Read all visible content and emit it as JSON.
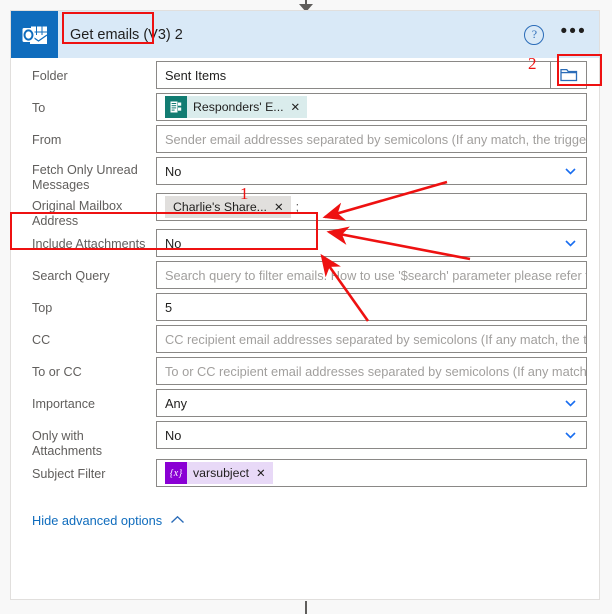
{
  "connector": {
    "top_icon": "arrow-down",
    "bottom_icon": "vertical-line"
  },
  "header": {
    "app_icon": "outlook-icon",
    "title": "Get emails (V3) 2",
    "help_icon": "help-icon",
    "help_glyph": "?",
    "more_icon": "ellipsis-icon",
    "more_glyph": "•••",
    "background_color": "#d9e9f7",
    "icon_color": "#0f6cbd"
  },
  "fields": [
    {
      "label": "Folder",
      "type": "text-with-picker",
      "value": "Sent Items",
      "is_placeholder": false,
      "picker_icon": "folder-icon"
    },
    {
      "label": "To",
      "type": "token",
      "token": {
        "text": "Responders' E...",
        "icon": "forms-icon",
        "style": "forms",
        "remove_glyph": "✕"
      }
    },
    {
      "label": "From",
      "type": "text",
      "value": "Sender email addresses separated by semicolons (If any match, the trigger will fire.)",
      "is_placeholder": true
    },
    {
      "label": "Fetch Only Unread Messages",
      "type": "dropdown",
      "value": "No",
      "is_placeholder": false,
      "chevron_icon": "chevron-down-icon"
    },
    {
      "label": "Original Mailbox Address",
      "type": "token",
      "token": {
        "text": "Charlie's Share...",
        "style": "plain",
        "remove_glyph": "✕"
      },
      "trailing_text": ";"
    },
    {
      "label": "Include Attachments",
      "type": "dropdown",
      "value": "No",
      "is_placeholder": false,
      "chevron_icon": "chevron-down-icon"
    },
    {
      "label": "Search Query",
      "type": "text",
      "value": "Search query to filter emails. How to use '$search' parameter please refer to: htt",
      "is_placeholder": true
    },
    {
      "label": "Top",
      "type": "text",
      "value": "5",
      "is_placeholder": false
    },
    {
      "label": "CC",
      "type": "text",
      "value": "CC recipient email addresses separated by semicolons (If any match, the trigger will fire.)",
      "is_placeholder": true
    },
    {
      "label": "To or CC",
      "type": "text",
      "value": "To or CC recipient email addresses separated by semicolons (If any match, the trigger will fire.)",
      "is_placeholder": true
    },
    {
      "label": "Importance",
      "type": "dropdown",
      "value": "Any",
      "is_placeholder": false,
      "chevron_icon": "chevron-down-icon"
    },
    {
      "label": "Only with Attachments",
      "type": "dropdown",
      "value": "No",
      "is_placeholder": false,
      "chevron_icon": "chevron-down-icon"
    },
    {
      "label": "Subject Filter",
      "type": "token",
      "token": {
        "text": "varsubject",
        "icon": "variable-icon",
        "icon_glyph": "{x}",
        "style": "variable",
        "remove_glyph": "✕"
      }
    }
  ],
  "footer": {
    "advanced_options_label": "Hide advanced options",
    "chevron_icon": "chevron-up-icon"
  },
  "annotations": {
    "color": "#ee1111",
    "numbers": [
      {
        "label": "1"
      },
      {
        "label": "2"
      }
    ],
    "boxes": [
      {
        "target": "header-title"
      },
      {
        "target": "folder-picker-button"
      },
      {
        "target": "original-mailbox-address-row"
      }
    ],
    "arrows": 3
  }
}
